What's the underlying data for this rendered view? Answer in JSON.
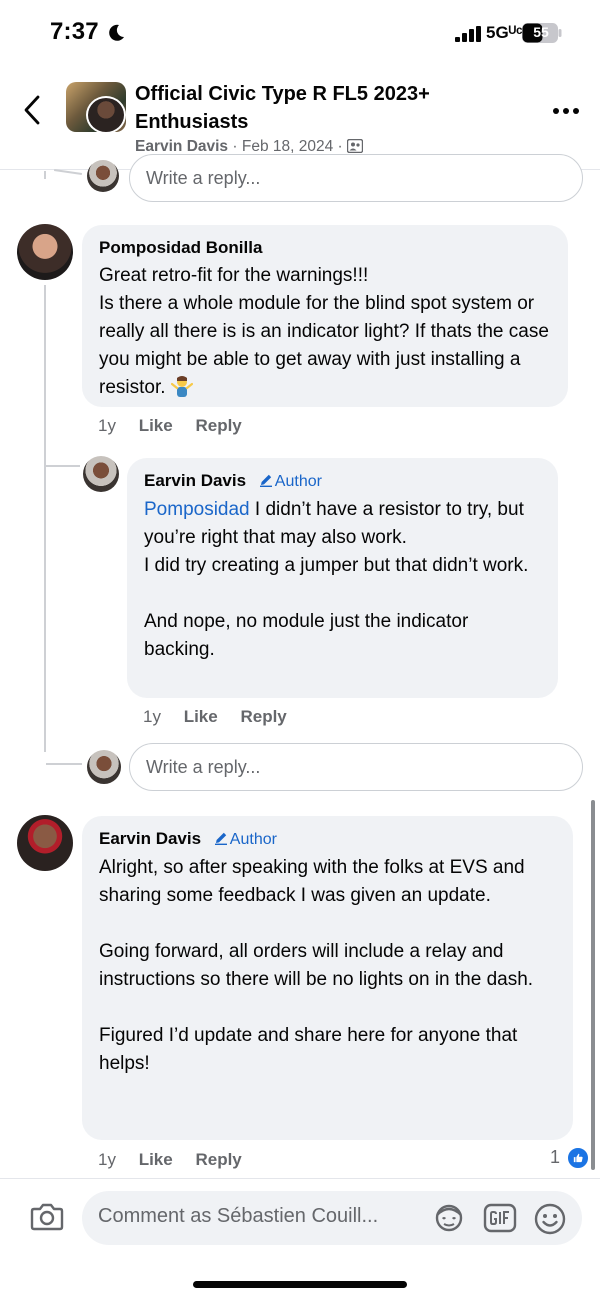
{
  "status_bar": {
    "time": "7:37",
    "network": "5Gᵁᶜ",
    "battery": "55"
  },
  "header": {
    "group_title": "Official Civic Type R FL5 2023+ Enthusiasts",
    "post_author": "Earvin Davis",
    "post_date": "Feb 18, 2024",
    "separator": "·"
  },
  "reply_placeholder": "Write a reply...",
  "comments": [
    {
      "name": "Pomposidad Bonilla",
      "body": "Great retro-fit for the warnings!!!\nIs there a whole module for the blind spot system or really all there is is an indicator light? If thats the case you might be able to get away with just installing a resistor.",
      "emoji": "person-shrugging",
      "age": "1y",
      "like": "Like",
      "reply": "Reply"
    },
    {
      "name": "Earvin Davis",
      "badge": "Author",
      "mention": "Pomposidad",
      "body": " I didn’t have a resistor to try, but you’re right that may also work.\nI did try creating a jumper but that didn’t work.\n\nAnd nope, no module just the indicator backing.",
      "age": "1y",
      "like": "Like",
      "reply": "Reply"
    },
    {
      "name": "Earvin Davis",
      "badge": "Author",
      "body": "Alright, so after speaking with the folks at EVS and sharing some feedback I was given an update.\n\nGoing forward, all orders will include a relay and instructions so there will be no lights on in the dash.\n\nFigured I’d update and share here for anyone that helps!",
      "age": "1y",
      "like": "Like",
      "reply": "Reply",
      "reaction_count": "1"
    }
  ],
  "composer": {
    "placeholder": "Comment as Sébastien Couill..."
  },
  "colors": {
    "link_blue": "#1a66c9",
    "bubble_bg": "#f0f2f5",
    "muted_text": "#65676b",
    "like_blue": "#1b74e4"
  }
}
